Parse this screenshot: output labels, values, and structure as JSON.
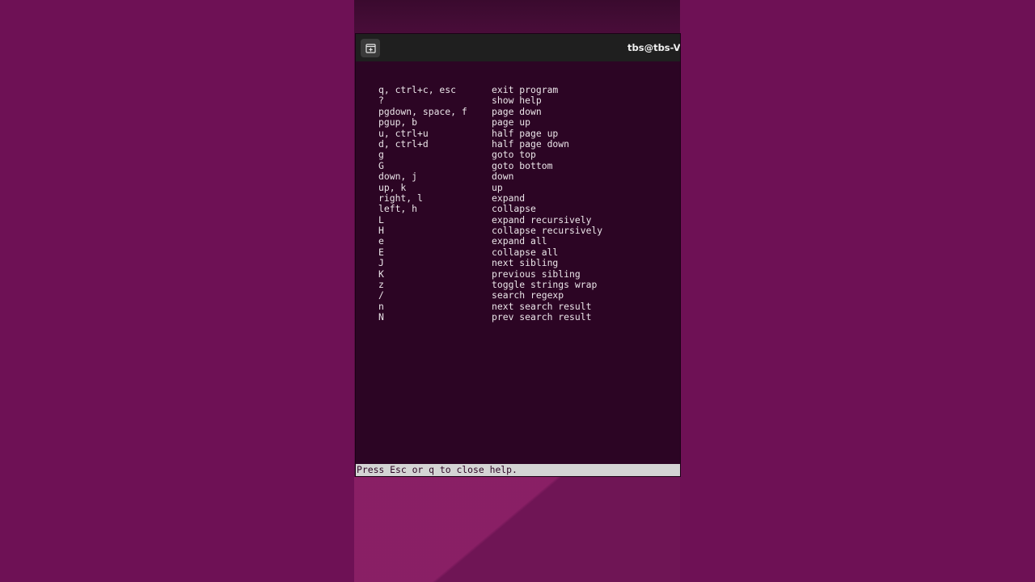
{
  "window": {
    "title": "tbs@tbs-Vi"
  },
  "titlebar": {
    "new_tab_icon": "new-tab-icon"
  },
  "help": {
    "rows": [
      {
        "key": "q, ctrl+c, esc",
        "desc": "exit program"
      },
      {
        "key": "?",
        "desc": "show help"
      },
      {
        "key": "pgdown, space, f",
        "desc": "page down"
      },
      {
        "key": "pgup, b",
        "desc": "page up"
      },
      {
        "key": "u, ctrl+u",
        "desc": "half page up"
      },
      {
        "key": "d, ctrl+d",
        "desc": "half page down"
      },
      {
        "key": "g",
        "desc": "goto top"
      },
      {
        "key": "G",
        "desc": "goto bottom"
      },
      {
        "key": "down, j",
        "desc": "down"
      },
      {
        "key": "up, k",
        "desc": "up"
      },
      {
        "key": "right, l",
        "desc": "expand"
      },
      {
        "key": "left, h",
        "desc": "collapse"
      },
      {
        "key": "L",
        "desc": "expand recursively"
      },
      {
        "key": "H",
        "desc": "collapse recursively"
      },
      {
        "key": "e",
        "desc": "expand all"
      },
      {
        "key": "E",
        "desc": "collapse all"
      },
      {
        "key": "J",
        "desc": "next sibling"
      },
      {
        "key": "K",
        "desc": "previous sibling"
      },
      {
        "key": "z",
        "desc": "toggle strings wrap"
      },
      {
        "key": "/",
        "desc": "search regexp"
      },
      {
        "key": "n",
        "desc": "next search result"
      },
      {
        "key": "N",
        "desc": "prev search result"
      }
    ]
  },
  "status": {
    "text": "Press Esc or q to close help."
  },
  "colors": {
    "background": "#6e1155",
    "terminal_bg": "#2c0524",
    "titlebar_bg": "#1f1f1f",
    "text": "#ebe5e9",
    "status_bg": "#d4d4d4"
  }
}
